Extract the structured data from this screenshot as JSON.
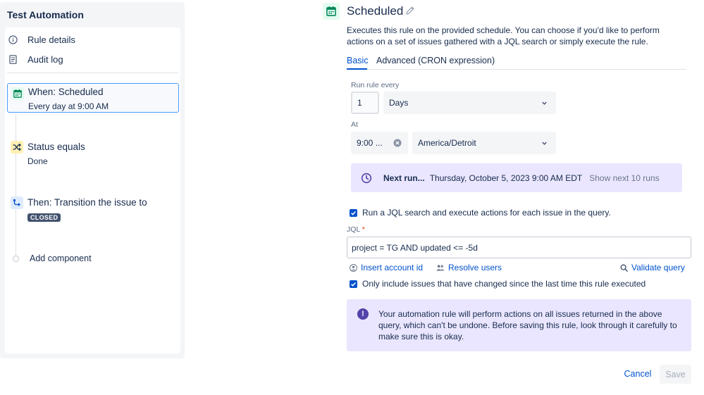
{
  "sidebar": {
    "title": "Test Automation",
    "rule_details": "Rule details",
    "audit_log": "Audit log",
    "trigger": {
      "title": "When: Scheduled",
      "subtitle": "Every day at 9:00 AM"
    },
    "condition": {
      "title": "Status equals",
      "subtitle": "Done"
    },
    "action": {
      "title": "Then: Transition the issue to",
      "badge": "CLOSED"
    },
    "add_component": "Add component"
  },
  "main": {
    "title": "Scheduled",
    "description": "Executes this rule on the provided schedule. You can choose if you'd like to perform actions on a set of issues gathered with a JQL search or simply execute the rule.",
    "tabs": [
      {
        "label": "Basic",
        "active": true
      },
      {
        "label": "Advanced (CRON expression)",
        "active": false
      }
    ],
    "run_every": {
      "label": "Run rule every",
      "value": "1",
      "unit": "Days"
    },
    "at": {
      "label": "At",
      "time": "9:00 ...",
      "timezone": "America/Detroit"
    },
    "next_run": {
      "label": "Next run...",
      "date": "Thursday, October 5, 2023 9:00 AM EDT",
      "link": "Show next 10 runs"
    },
    "jql_checkbox": {
      "label": "Run a JQL search and execute actions for each issue in the query.",
      "checked": true
    },
    "jql": {
      "label": "JQL",
      "required_mark": "*",
      "value": "project = TG AND  updated <= -5d"
    },
    "links": {
      "insert_account_id": "Insert account id",
      "resolve_users": "Resolve users",
      "validate_query": "Validate query"
    },
    "only_changed_checkbox": {
      "label": "Only include issues that have changed since the last time this rule executed",
      "checked": true
    },
    "warning": {
      "icon": "!",
      "text": "Your automation rule will perform actions on all issues returned in the above query, which can't be undone. Before saving this rule, look through it carefully to make sure this is okay."
    },
    "buttons": {
      "cancel": "Cancel",
      "save": "Save"
    }
  },
  "colors": {
    "accent": "#0052cc",
    "selected_border": "#4c9aff",
    "info_bg": "#eae6ff",
    "info_icon": "#5243aa"
  }
}
